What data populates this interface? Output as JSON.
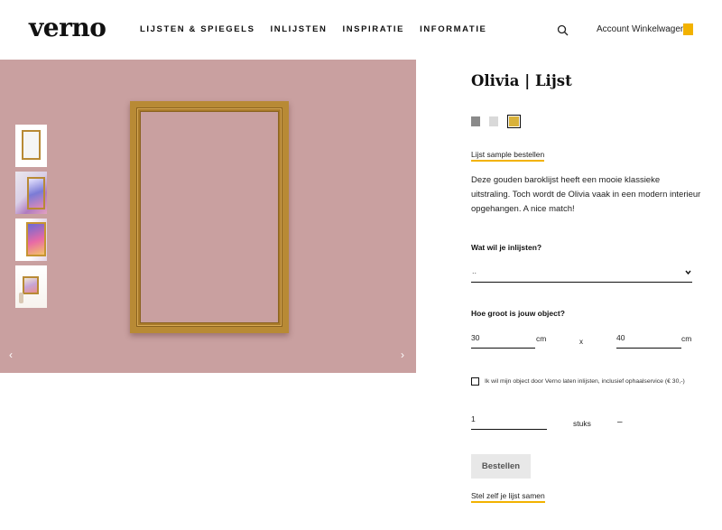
{
  "brand": {
    "logo": "verno",
    "accent_color": "#f2b200"
  },
  "nav": {
    "items": [
      "LIJSTEN & SPIEGELS",
      "INLIJSTEN",
      "INSPIRATIE",
      "INFORMATIE"
    ]
  },
  "header": {
    "search_icon": "search-icon",
    "account": "Account",
    "cart": "Winkelwagen",
    "cart_badge_color": "#f2b200"
  },
  "gallery": {
    "background_color": "#c9a0a0",
    "frame_color": "#b88a35",
    "thumbnails": [
      "frame-only",
      "frame-with-art-hand",
      "frame-with-art-angle",
      "frame-in-room"
    ],
    "prev_arrow": "‹",
    "next_arrow": "›"
  },
  "product": {
    "title": "Olivia | Lijst",
    "swatches": [
      {
        "name": "dark-grey",
        "color": "#8a8a8a",
        "selected": false
      },
      {
        "name": "light-grey",
        "color": "#d9d9d9",
        "selected": false
      },
      {
        "name": "gold",
        "color": "#d9b23a",
        "selected": true
      }
    ],
    "sample_link": "Lijst sample bestellen",
    "description": "Deze gouden baroklijst heeft een mooie klassieke uitstraling. Toch wordt de Olivia vaak in een modern interieur opgehangen. A nice match!"
  },
  "form": {
    "object_label": "Wat wil je inlijsten?",
    "object_value": "..",
    "size_label": "Hoe groot is jouw object?",
    "width": "30",
    "height": "40",
    "unit": "cm",
    "times": "x",
    "service_checkbox_label": "Ik wil mijn object door Verno laten inlijsten, inclusief ophaalservice (€ 30,-)",
    "service_checked": false,
    "quantity": "1",
    "quantity_unit": "stuks",
    "quantity_dash": "–",
    "order_button": "Bestellen",
    "compose_link": "Stel zelf je lijst samen"
  }
}
